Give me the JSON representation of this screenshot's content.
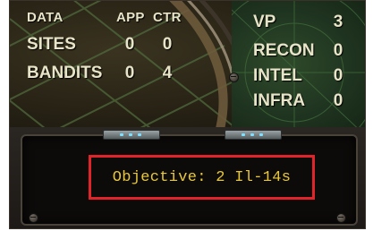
{
  "data_panel": {
    "header": "DATA",
    "col_app": "APP",
    "col_ctr": "CTR",
    "rows": [
      {
        "label": "SITES",
        "app": "0",
        "ctr": "0"
      },
      {
        "label": "BANDITS",
        "app": "0",
        "ctr": "4"
      }
    ]
  },
  "score_panel": {
    "vp_label": "VP",
    "vp_value": "3",
    "rows": [
      {
        "label": "RECON",
        "value": "0"
      },
      {
        "label": "INTEL",
        "value": "0"
      },
      {
        "label": "INFRA",
        "value": "0"
      }
    ]
  },
  "objective": {
    "text": "Objective: 2 Il-14s"
  },
  "colors": {
    "objective_text": "#e8c83a",
    "highlight_border": "#e0242a",
    "stat_text": "#e8e4c8"
  }
}
